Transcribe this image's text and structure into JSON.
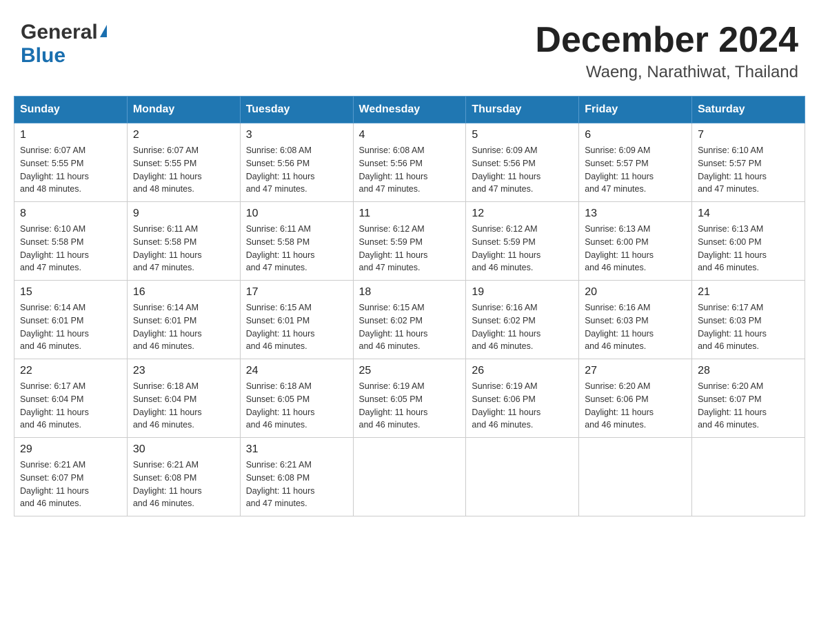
{
  "header": {
    "logo_general": "General",
    "logo_blue": "Blue",
    "month_title": "December 2024",
    "location": "Waeng, Narathiwat, Thailand"
  },
  "days_of_week": [
    "Sunday",
    "Monday",
    "Tuesday",
    "Wednesday",
    "Thursday",
    "Friday",
    "Saturday"
  ],
  "weeks": [
    [
      {
        "day": "1",
        "sunrise": "6:07 AM",
        "sunset": "5:55 PM",
        "daylight": "11 hours and 48 minutes."
      },
      {
        "day": "2",
        "sunrise": "6:07 AM",
        "sunset": "5:55 PM",
        "daylight": "11 hours and 48 minutes."
      },
      {
        "day": "3",
        "sunrise": "6:08 AM",
        "sunset": "5:56 PM",
        "daylight": "11 hours and 47 minutes."
      },
      {
        "day": "4",
        "sunrise": "6:08 AM",
        "sunset": "5:56 PM",
        "daylight": "11 hours and 47 minutes."
      },
      {
        "day": "5",
        "sunrise": "6:09 AM",
        "sunset": "5:56 PM",
        "daylight": "11 hours and 47 minutes."
      },
      {
        "day": "6",
        "sunrise": "6:09 AM",
        "sunset": "5:57 PM",
        "daylight": "11 hours and 47 minutes."
      },
      {
        "day": "7",
        "sunrise": "6:10 AM",
        "sunset": "5:57 PM",
        "daylight": "11 hours and 47 minutes."
      }
    ],
    [
      {
        "day": "8",
        "sunrise": "6:10 AM",
        "sunset": "5:58 PM",
        "daylight": "11 hours and 47 minutes."
      },
      {
        "day": "9",
        "sunrise": "6:11 AM",
        "sunset": "5:58 PM",
        "daylight": "11 hours and 47 minutes."
      },
      {
        "day": "10",
        "sunrise": "6:11 AM",
        "sunset": "5:58 PM",
        "daylight": "11 hours and 47 minutes."
      },
      {
        "day": "11",
        "sunrise": "6:12 AM",
        "sunset": "5:59 PM",
        "daylight": "11 hours and 47 minutes."
      },
      {
        "day": "12",
        "sunrise": "6:12 AM",
        "sunset": "5:59 PM",
        "daylight": "11 hours and 46 minutes."
      },
      {
        "day": "13",
        "sunrise": "6:13 AM",
        "sunset": "6:00 PM",
        "daylight": "11 hours and 46 minutes."
      },
      {
        "day": "14",
        "sunrise": "6:13 AM",
        "sunset": "6:00 PM",
        "daylight": "11 hours and 46 minutes."
      }
    ],
    [
      {
        "day": "15",
        "sunrise": "6:14 AM",
        "sunset": "6:01 PM",
        "daylight": "11 hours and 46 minutes."
      },
      {
        "day": "16",
        "sunrise": "6:14 AM",
        "sunset": "6:01 PM",
        "daylight": "11 hours and 46 minutes."
      },
      {
        "day": "17",
        "sunrise": "6:15 AM",
        "sunset": "6:01 PM",
        "daylight": "11 hours and 46 minutes."
      },
      {
        "day": "18",
        "sunrise": "6:15 AM",
        "sunset": "6:02 PM",
        "daylight": "11 hours and 46 minutes."
      },
      {
        "day": "19",
        "sunrise": "6:16 AM",
        "sunset": "6:02 PM",
        "daylight": "11 hours and 46 minutes."
      },
      {
        "day": "20",
        "sunrise": "6:16 AM",
        "sunset": "6:03 PM",
        "daylight": "11 hours and 46 minutes."
      },
      {
        "day": "21",
        "sunrise": "6:17 AM",
        "sunset": "6:03 PM",
        "daylight": "11 hours and 46 minutes."
      }
    ],
    [
      {
        "day": "22",
        "sunrise": "6:17 AM",
        "sunset": "6:04 PM",
        "daylight": "11 hours and 46 minutes."
      },
      {
        "day": "23",
        "sunrise": "6:18 AM",
        "sunset": "6:04 PM",
        "daylight": "11 hours and 46 minutes."
      },
      {
        "day": "24",
        "sunrise": "6:18 AM",
        "sunset": "6:05 PM",
        "daylight": "11 hours and 46 minutes."
      },
      {
        "day": "25",
        "sunrise": "6:19 AM",
        "sunset": "6:05 PM",
        "daylight": "11 hours and 46 minutes."
      },
      {
        "day": "26",
        "sunrise": "6:19 AM",
        "sunset": "6:06 PM",
        "daylight": "11 hours and 46 minutes."
      },
      {
        "day": "27",
        "sunrise": "6:20 AM",
        "sunset": "6:06 PM",
        "daylight": "11 hours and 46 minutes."
      },
      {
        "day": "28",
        "sunrise": "6:20 AM",
        "sunset": "6:07 PM",
        "daylight": "11 hours and 46 minutes."
      }
    ],
    [
      {
        "day": "29",
        "sunrise": "6:21 AM",
        "sunset": "6:07 PM",
        "daylight": "11 hours and 46 minutes."
      },
      {
        "day": "30",
        "sunrise": "6:21 AM",
        "sunset": "6:08 PM",
        "daylight": "11 hours and 46 minutes."
      },
      {
        "day": "31",
        "sunrise": "6:21 AM",
        "sunset": "6:08 PM",
        "daylight": "11 hours and 47 minutes."
      },
      null,
      null,
      null,
      null
    ]
  ],
  "labels": {
    "sunrise": "Sunrise:",
    "sunset": "Sunset:",
    "daylight": "Daylight:"
  }
}
